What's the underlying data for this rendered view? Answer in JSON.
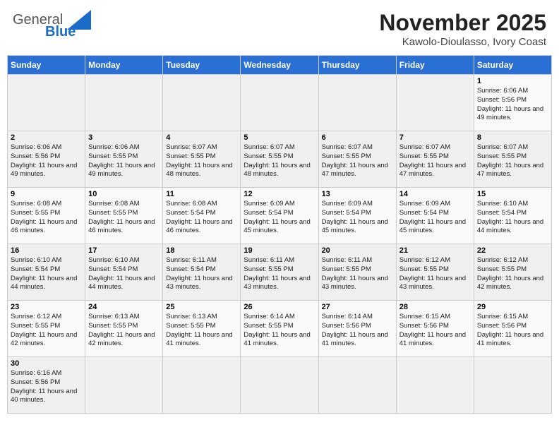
{
  "header": {
    "logo_general": "General",
    "logo_blue": "Blue",
    "title": "November 2025",
    "subtitle": "Kawolo-Dioulasso, Ivory Coast"
  },
  "days_of_week": [
    "Sunday",
    "Monday",
    "Tuesday",
    "Wednesday",
    "Thursday",
    "Friday",
    "Saturday"
  ],
  "weeks": [
    [
      {
        "day": "",
        "info": ""
      },
      {
        "day": "",
        "info": ""
      },
      {
        "day": "",
        "info": ""
      },
      {
        "day": "",
        "info": ""
      },
      {
        "day": "",
        "info": ""
      },
      {
        "day": "",
        "info": ""
      },
      {
        "day": "1",
        "info": "Sunrise: 6:06 AM\nSunset: 5:56 PM\nDaylight: 11 hours and 49 minutes."
      }
    ],
    [
      {
        "day": "2",
        "info": "Sunrise: 6:06 AM\nSunset: 5:56 PM\nDaylight: 11 hours and 49 minutes."
      },
      {
        "day": "3",
        "info": "Sunrise: 6:06 AM\nSunset: 5:55 PM\nDaylight: 11 hours and 49 minutes."
      },
      {
        "day": "4",
        "info": "Sunrise: 6:07 AM\nSunset: 5:55 PM\nDaylight: 11 hours and 48 minutes."
      },
      {
        "day": "5",
        "info": "Sunrise: 6:07 AM\nSunset: 5:55 PM\nDaylight: 11 hours and 48 minutes."
      },
      {
        "day": "6",
        "info": "Sunrise: 6:07 AM\nSunset: 5:55 PM\nDaylight: 11 hours and 47 minutes."
      },
      {
        "day": "7",
        "info": "Sunrise: 6:07 AM\nSunset: 5:55 PM\nDaylight: 11 hours and 47 minutes."
      },
      {
        "day": "8",
        "info": "Sunrise: 6:07 AM\nSunset: 5:55 PM\nDaylight: 11 hours and 47 minutes."
      }
    ],
    [
      {
        "day": "9",
        "info": "Sunrise: 6:08 AM\nSunset: 5:55 PM\nDaylight: 11 hours and 46 minutes."
      },
      {
        "day": "10",
        "info": "Sunrise: 6:08 AM\nSunset: 5:55 PM\nDaylight: 11 hours and 46 minutes."
      },
      {
        "day": "11",
        "info": "Sunrise: 6:08 AM\nSunset: 5:54 PM\nDaylight: 11 hours and 46 minutes."
      },
      {
        "day": "12",
        "info": "Sunrise: 6:09 AM\nSunset: 5:54 PM\nDaylight: 11 hours and 45 minutes."
      },
      {
        "day": "13",
        "info": "Sunrise: 6:09 AM\nSunset: 5:54 PM\nDaylight: 11 hours and 45 minutes."
      },
      {
        "day": "14",
        "info": "Sunrise: 6:09 AM\nSunset: 5:54 PM\nDaylight: 11 hours and 45 minutes."
      },
      {
        "day": "15",
        "info": "Sunrise: 6:10 AM\nSunset: 5:54 PM\nDaylight: 11 hours and 44 minutes."
      }
    ],
    [
      {
        "day": "16",
        "info": "Sunrise: 6:10 AM\nSunset: 5:54 PM\nDaylight: 11 hours and 44 minutes."
      },
      {
        "day": "17",
        "info": "Sunrise: 6:10 AM\nSunset: 5:54 PM\nDaylight: 11 hours and 44 minutes."
      },
      {
        "day": "18",
        "info": "Sunrise: 6:11 AM\nSunset: 5:54 PM\nDaylight: 11 hours and 43 minutes."
      },
      {
        "day": "19",
        "info": "Sunrise: 6:11 AM\nSunset: 5:55 PM\nDaylight: 11 hours and 43 minutes."
      },
      {
        "day": "20",
        "info": "Sunrise: 6:11 AM\nSunset: 5:55 PM\nDaylight: 11 hours and 43 minutes."
      },
      {
        "day": "21",
        "info": "Sunrise: 6:12 AM\nSunset: 5:55 PM\nDaylight: 11 hours and 43 minutes."
      },
      {
        "day": "22",
        "info": "Sunrise: 6:12 AM\nSunset: 5:55 PM\nDaylight: 11 hours and 42 minutes."
      }
    ],
    [
      {
        "day": "23",
        "info": "Sunrise: 6:12 AM\nSunset: 5:55 PM\nDaylight: 11 hours and 42 minutes."
      },
      {
        "day": "24",
        "info": "Sunrise: 6:13 AM\nSunset: 5:55 PM\nDaylight: 11 hours and 42 minutes."
      },
      {
        "day": "25",
        "info": "Sunrise: 6:13 AM\nSunset: 5:55 PM\nDaylight: 11 hours and 41 minutes."
      },
      {
        "day": "26",
        "info": "Sunrise: 6:14 AM\nSunset: 5:55 PM\nDaylight: 11 hours and 41 minutes."
      },
      {
        "day": "27",
        "info": "Sunrise: 6:14 AM\nSunset: 5:56 PM\nDaylight: 11 hours and 41 minutes."
      },
      {
        "day": "28",
        "info": "Sunrise: 6:15 AM\nSunset: 5:56 PM\nDaylight: 11 hours and 41 minutes."
      },
      {
        "day": "29",
        "info": "Sunrise: 6:15 AM\nSunset: 5:56 PM\nDaylight: 11 hours and 41 minutes."
      }
    ],
    [
      {
        "day": "30",
        "info": "Sunrise: 6:16 AM\nSunset: 5:56 PM\nDaylight: 11 hours and 40 minutes."
      },
      {
        "day": "",
        "info": ""
      },
      {
        "day": "",
        "info": ""
      },
      {
        "day": "",
        "info": ""
      },
      {
        "day": "",
        "info": ""
      },
      {
        "day": "",
        "info": ""
      },
      {
        "day": "",
        "info": ""
      }
    ]
  ]
}
